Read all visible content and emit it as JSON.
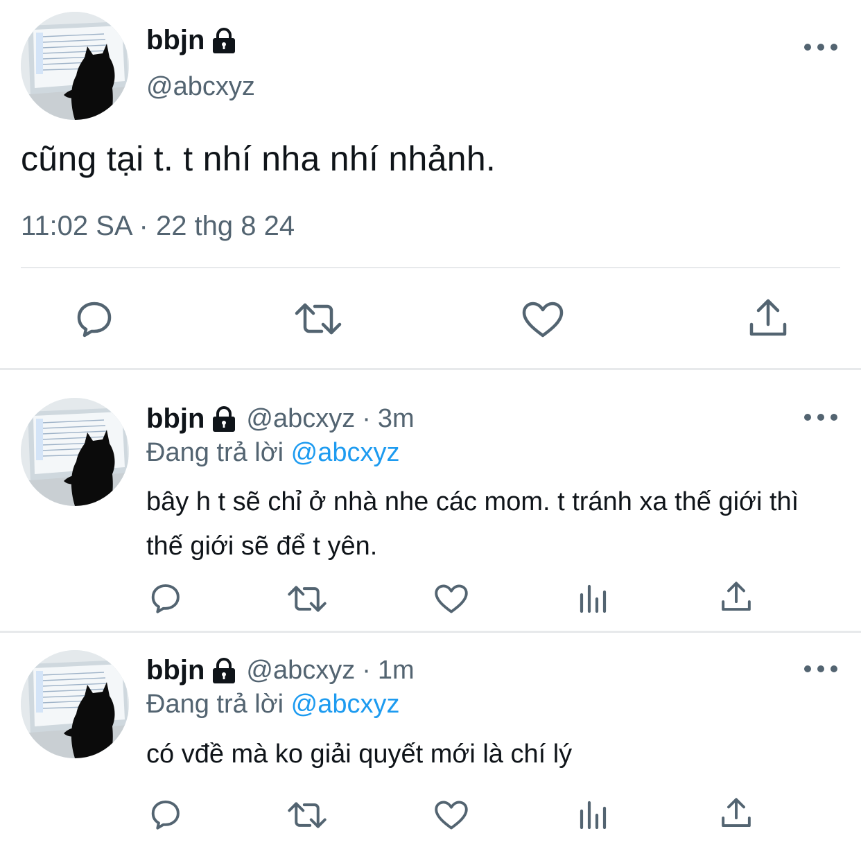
{
  "main_tweet": {
    "display_name": "bbjn",
    "handle": "@abcxyz",
    "text": "cũng tại t. t nhí nha nhí nhảnh.",
    "timestamp": "11:02 SA · 22 thg 8 24",
    "icons": [
      "lock-icon",
      "more-icon",
      "reply-icon",
      "retweet-icon",
      "like-icon",
      "share-icon"
    ]
  },
  "replies": [
    {
      "display_name": "bbjn",
      "handle": "@abcxyz",
      "separator": "·",
      "time": "3m",
      "replying_label": "Đang trả lời",
      "replying_to": "@abcxyz",
      "text": "bây h t sẽ chỉ ở nhà nhe các mom. t tránh xa thế giới thì thế giới sẽ để t yên."
    },
    {
      "display_name": "bbjn",
      "handle": "@abcxyz",
      "separator": "·",
      "time": "1m",
      "replying_label": "Đang trả lời",
      "replying_to": "@abcxyz",
      "text": "có vđề mà ko giải quyết mới là chí lý"
    }
  ],
  "colors": {
    "text_primary": "#0f1419",
    "text_secondary": "#536471",
    "mention": "#1d9bf0",
    "divider": "#e7e9eb"
  }
}
